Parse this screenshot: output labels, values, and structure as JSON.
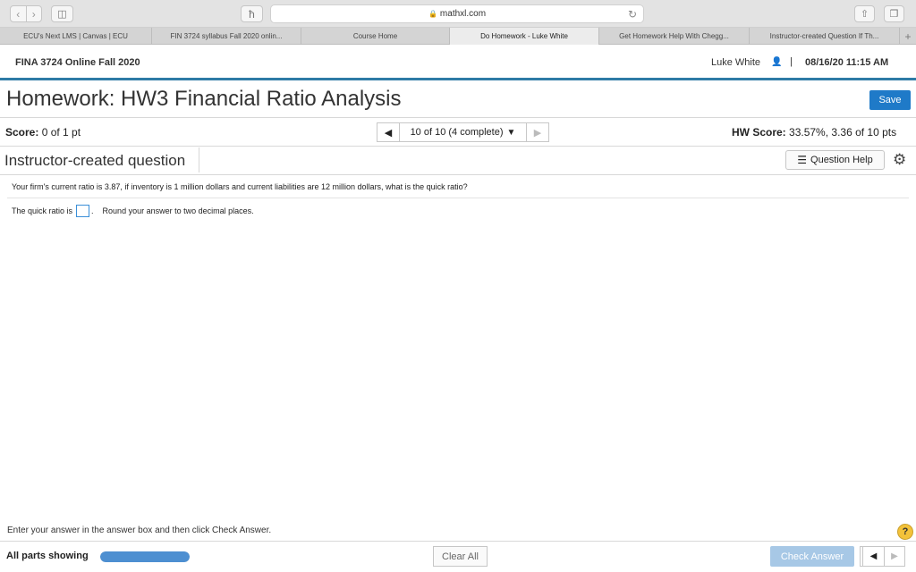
{
  "browser": {
    "url": "mathxl.com",
    "reader_icon": "ћ",
    "tabs": [
      {
        "label": "ECU's Next LMS | Canvas | ECU",
        "active": false
      },
      {
        "label": "FIN 3724 syllabus Fall 2020 onlin...",
        "active": false
      },
      {
        "label": "Course Home",
        "active": false
      },
      {
        "label": "Do Homework - Luke White",
        "active": true
      },
      {
        "label": "Get Homework Help With Chegg...",
        "active": false
      },
      {
        "label": "Instructor-created Question If Th...",
        "active": false
      }
    ],
    "new_tab": "+"
  },
  "course_header": {
    "course": "FINA 3724 Online Fall 2020",
    "user": "Luke White",
    "separator": "|",
    "datetime": "08/16/20 11:15 AM"
  },
  "homework": {
    "title": "Homework: HW3 Financial Ratio Analysis",
    "save_label": "Save",
    "score_label": "Score:",
    "score_value": "0 of 1 pt",
    "question_selector": "10 of 10 (4 complete)",
    "hw_score_label": "HW Score:",
    "hw_score_value": "33.57%, 3.36 of 10 pts"
  },
  "question": {
    "heading": "Instructor-created question",
    "help_label": "Question Help",
    "text": "Your firm's current ratio is 3.87, if inventory is 1 million dollars and current liabilities are 12 million dollars, what is the quick ratio?",
    "answer_prefix": "The quick ratio is",
    "answer_value": "",
    "answer_suffix": ".",
    "round_note": "Round your answer to two decimal places."
  },
  "footer": {
    "instructions": "Enter your answer in the answer box and then click Check Answer.",
    "help_symbol": "?",
    "parts_label": "All parts showing",
    "progress": 1.0,
    "clear_label": "Clear All",
    "check_label": "Check Answer"
  },
  "colors": {
    "accent_blue": "#1f7ac8",
    "header_rule": "#2e7ba6",
    "check_disabled": "#a7c8e6",
    "help_yellow": "#f3c23a"
  }
}
